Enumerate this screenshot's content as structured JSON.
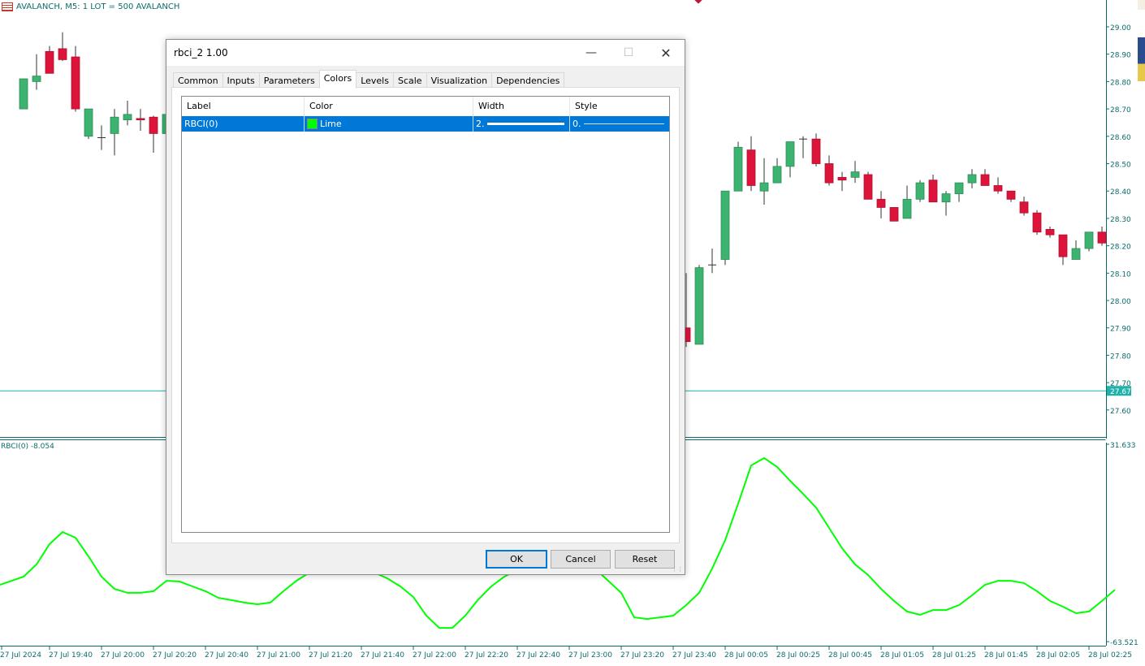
{
  "chart": {
    "title": "AVALANCH, M5:  1 LOT = 500 AVALANCH",
    "current_price": "27.67",
    "price_ticks": [
      "29.00",
      "28.90",
      "28.80",
      "28.70",
      "28.60",
      "28.50",
      "28.40",
      "28.30",
      "28.20",
      "28.10",
      "28.00",
      "27.90",
      "27.80",
      "27.70",
      "27.60"
    ],
    "bull_color": "#3cb371",
    "bear_color": "#dc143c",
    "axis_color": "#0b6b6b",
    "candles_visible": [
      {
        "i": 1,
        "ohlc": [
          28.7,
          28.81,
          28.7,
          28.81
        ]
      },
      {
        "i": 2,
        "ohlc": [
          28.8,
          28.9,
          28.77,
          28.82
        ]
      },
      {
        "i": 3,
        "ohlc": [
          28.91,
          28.93,
          28.83,
          28.83
        ]
      },
      {
        "i": 4,
        "ohlc": [
          28.92,
          28.98,
          28.875,
          28.88
        ]
      },
      {
        "i": 5,
        "ohlc": [
          28.89,
          28.93,
          28.69,
          28.7
        ]
      },
      {
        "i": 6,
        "ohlc": [
          28.6,
          28.7,
          28.59,
          28.7
        ]
      },
      {
        "i": 7,
        "ohlc": [
          28.595,
          28.64,
          28.55,
          28.595
        ]
      },
      {
        "i": 8,
        "ohlc": [
          28.61,
          28.7,
          28.53,
          28.67
        ]
      },
      {
        "i": 9,
        "ohlc": [
          28.66,
          28.73,
          28.64,
          28.68
        ]
      },
      {
        "i": 10,
        "ohlc": [
          28.665,
          28.7,
          28.62,
          28.66
        ]
      },
      {
        "i": 11,
        "ohlc": [
          28.67,
          28.675,
          28.54,
          28.61
        ]
      },
      {
        "i": 12,
        "ohlc": [
          28.61,
          28.73,
          28.59,
          28.68
        ]
      },
      {
        "i": 13,
        "ohlc": [
          28.66,
          28.68,
          28.55,
          28.56
        ]
      },
      {
        "i": 52,
        "ohlc": [
          27.9,
          28.1,
          27.83,
          27.85
        ]
      },
      {
        "i": 53,
        "ohlc": [
          27.84,
          28.13,
          27.84,
          28.12
        ]
      },
      {
        "i": 54,
        "ohlc": [
          28.13,
          28.19,
          28.1,
          28.13
        ]
      },
      {
        "i": 55,
        "ohlc": [
          28.15,
          28.4,
          28.13,
          28.4
        ]
      },
      {
        "i": 56,
        "ohlc": [
          28.4,
          28.58,
          28.4,
          28.56
        ]
      },
      {
        "i": 57,
        "ohlc": [
          28.55,
          28.6,
          28.4,
          28.42
        ]
      },
      {
        "i": 58,
        "ohlc": [
          28.4,
          28.52,
          28.35,
          28.43
        ]
      },
      {
        "i": 59,
        "ohlc": [
          28.43,
          28.52,
          28.43,
          28.49
        ]
      },
      {
        "i": 60,
        "ohlc": [
          28.49,
          28.58,
          28.45,
          28.58
        ]
      },
      {
        "i": 61,
        "ohlc": [
          28.59,
          28.6,
          28.52,
          28.59
        ]
      },
      {
        "i": 62,
        "ohlc": [
          28.59,
          28.61,
          28.49,
          28.5
        ]
      },
      {
        "i": 63,
        "ohlc": [
          28.5,
          28.53,
          28.42,
          28.43
        ]
      },
      {
        "i": 64,
        "ohlc": [
          28.45,
          28.47,
          28.4,
          28.44
        ]
      },
      {
        "i": 65,
        "ohlc": [
          28.45,
          28.51,
          28.43,
          28.47
        ]
      },
      {
        "i": 66,
        "ohlc": [
          28.46,
          28.47,
          28.37,
          28.37
        ]
      },
      {
        "i": 67,
        "ohlc": [
          28.37,
          28.4,
          28.3,
          28.34
        ]
      },
      {
        "i": 68,
        "ohlc": [
          28.34,
          28.34,
          28.29,
          28.29
        ]
      },
      {
        "i": 69,
        "ohlc": [
          28.3,
          28.42,
          28.3,
          28.37
        ]
      },
      {
        "i": 70,
        "ohlc": [
          28.37,
          28.44,
          28.36,
          28.43
        ]
      },
      {
        "i": 71,
        "ohlc": [
          28.44,
          28.46,
          28.36,
          28.36
        ]
      },
      {
        "i": 72,
        "ohlc": [
          28.36,
          28.4,
          28.31,
          28.39
        ]
      },
      {
        "i": 73,
        "ohlc": [
          28.39,
          28.43,
          28.36,
          28.43
        ]
      },
      {
        "i": 74,
        "ohlc": [
          28.43,
          28.48,
          28.41,
          28.46
        ]
      },
      {
        "i": 75,
        "ohlc": [
          28.46,
          28.48,
          28.42,
          28.42
        ]
      },
      {
        "i": 76,
        "ohlc": [
          28.42,
          28.45,
          28.39,
          28.4
        ]
      },
      {
        "i": 77,
        "ohlc": [
          28.4,
          28.4,
          28.36,
          28.37
        ]
      },
      {
        "i": 78,
        "ohlc": [
          28.36,
          28.38,
          28.31,
          28.32
        ]
      },
      {
        "i": 79,
        "ohlc": [
          28.32,
          28.33,
          28.24,
          28.25
        ]
      },
      {
        "i": 80,
        "ohlc": [
          28.26,
          28.27,
          28.23,
          28.24
        ]
      },
      {
        "i": 81,
        "ohlc": [
          28.24,
          28.24,
          28.13,
          28.16
        ]
      },
      {
        "i": 82,
        "ohlc": [
          28.15,
          28.22,
          28.15,
          28.19
        ]
      },
      {
        "i": 83,
        "ohlc": [
          28.19,
          28.25,
          28.18,
          28.25
        ]
      },
      {
        "i": 84,
        "ohlc": [
          28.25,
          28.27,
          28.2,
          28.21
        ]
      }
    ],
    "indicator": {
      "label": "RBCI(0) -8.054",
      "max_label": "31.633",
      "min_label": "-63.521",
      "color": "#00ff00",
      "values": [
        -36.1,
        -32.2,
        -26.3,
        -16.5,
        -10.7,
        -13.4,
        -22.4,
        -32.2,
        -38.1,
        -40.0,
        -40.0,
        -39.2,
        -34.2,
        -34.5,
        -36.9,
        -39.2,
        -42.4,
        -43.5,
        -44.7,
        -45.5,
        -44.7,
        -39.2,
        -34.2,
        -30.2,
        -28.3,
        -26.3,
        -26.3,
        -28.3,
        -30.2,
        -33.0,
        -36.9,
        -42.0,
        -51.0,
        -56.9,
        -56.9,
        -51.0,
        -43.2,
        -36.9,
        -32.2,
        -29.1,
        -28.3,
        -28.3,
        -28.3,
        -28.3,
        -27.5,
        -28.3,
        -34.2,
        -40.0,
        -51.8,
        -52.6,
        -51.8,
        -51.0,
        -45.9,
        -40.0,
        -28.3,
        -14.6,
        3.0,
        21.4,
        25.0,
        20.7,
        14.0,
        7.7,
        1.1,
        -8.7,
        -18.5,
        -26.3,
        -31.4,
        -38.1,
        -43.9,
        -49.0,
        -50.6,
        -48.3,
        -48.3,
        -45.9,
        -41.2,
        -36.1,
        -34.2,
        -34.2,
        -35.3,
        -39.2,
        -43.9,
        -46.7,
        -49.8,
        -49.0,
        -43.9,
        -38.5
      ]
    },
    "time_labels": [
      "27 Jul 2024",
      "27 Jul 19:40",
      "27 Jul 20:00",
      "27 Jul 20:20",
      "27 Jul 20:40",
      "27 Jul 21:00",
      "27 Jul 21:20",
      "27 Jul 21:40",
      "27 Jul 22:00",
      "27 Jul 22:20",
      "27 Jul 22:40",
      "27 Jul 23:00",
      "27 Jul 23:20",
      "27 Jul 23:40",
      "28 Jul 00:05",
      "28 Jul 00:25",
      "28 Jul 00:45",
      "28 Jul 01:05",
      "28 Jul 01:25",
      "28 Jul 01:45",
      "28 Jul 02:05",
      "28 Jul 02:25"
    ]
  },
  "dialog": {
    "title": "rbci_2 1.00",
    "tabs": [
      {
        "label": "Common"
      },
      {
        "label": "Inputs"
      },
      {
        "label": "Parameters"
      },
      {
        "label": "Colors",
        "active": true
      },
      {
        "label": "Levels"
      },
      {
        "label": "Scale"
      },
      {
        "label": "Visualization"
      },
      {
        "label": "Dependencies"
      }
    ],
    "columns": [
      "Label",
      "Color",
      "Width",
      "Style"
    ],
    "rows": [
      {
        "label": "RBCI(0)",
        "color_name": "Lime",
        "color": "#00ff00",
        "width": "2.",
        "style": "0."
      }
    ],
    "buttons": {
      "ok": "OK",
      "cancel": "Cancel",
      "reset": "Reset"
    }
  }
}
